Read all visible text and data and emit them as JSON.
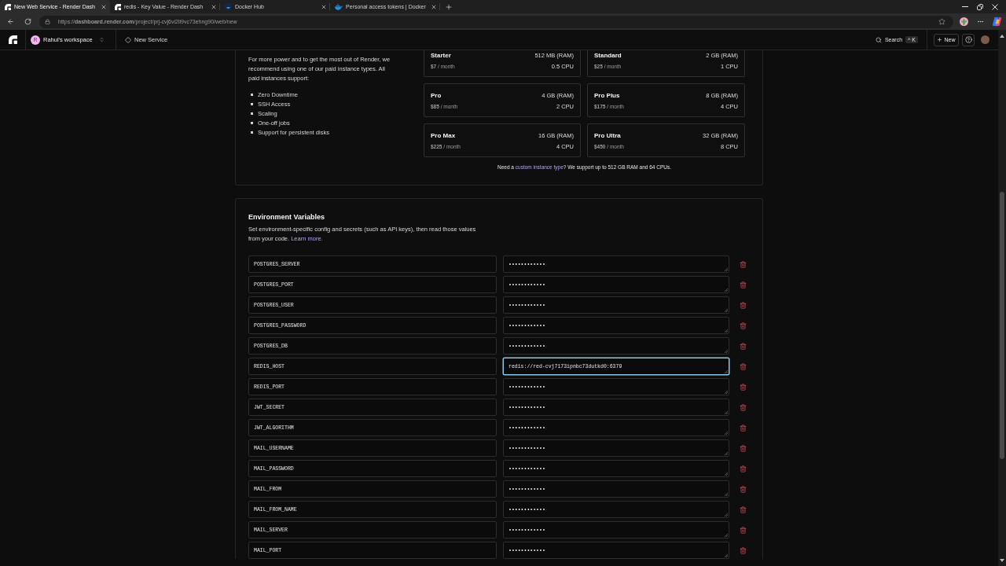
{
  "browser": {
    "tabs": [
      {
        "title": "New Web Service - Render Dash",
        "kind": "render",
        "selected": true
      },
      {
        "title": "redis - Key Value - Render Dash",
        "kind": "render",
        "selected": false
      },
      {
        "title": "Docker Hub",
        "kind": "docker-hub",
        "selected": false
      },
      {
        "title": "Personal access tokens | Docker",
        "kind": "docker",
        "selected": false
      }
    ],
    "address": "https://**dashboard.render.com**/project/prj-cvj6vi2li9vc73ehng90/web/new"
  },
  "header": {
    "workspace": {
      "initial": "R",
      "name": "Rahul's workspace"
    },
    "page": "New Service",
    "search": {
      "label": "Search",
      "shortcut": "^ K"
    },
    "new_button": "New"
  },
  "instances": {
    "description": "For more power and to get the most out of Render, we recommend using one of our paid instance types. All paid instances support:",
    "features": [
      "Zero Downtime",
      "SSH Access",
      "Scaling",
      "One-off jobs",
      "Support for persistent disks"
    ],
    "plans": [
      {
        "name": "Starter",
        "ram": "512 MB (RAM)",
        "price": "**$7** / month",
        "cpu": "0.5 CPU",
        "selected": false
      },
      {
        "name": "Standard",
        "ram": "2 GB (RAM)",
        "price": "**$25** / month",
        "cpu": "1 CPU",
        "selected": false
      },
      {
        "name": "Pro",
        "ram": "4 GB (RAM)",
        "price": "**$85** / month",
        "cpu": "2 CPU",
        "selected": false
      },
      {
        "name": "Pro Plus",
        "ram": "8 GB (RAM)",
        "price": "**$175** / month",
        "cpu": "4 CPU",
        "selected": false
      },
      {
        "name": "Pro Max",
        "ram": "16 GB (RAM)",
        "price": "**$225** / month",
        "cpu": "4 CPU",
        "selected": false
      },
      {
        "name": "Pro Ultra",
        "ram": "32 GB (RAM)",
        "price": "**$450** / month",
        "cpu": "8 CPU",
        "selected": false
      }
    ],
    "note": {
      "before": "Need a ",
      "link": "custom instance type",
      "after": "? We support up to 512 GB RAM and 64 CPUs."
    }
  },
  "environment": {
    "title": "Environment Variables",
    "description": "Set environment-specific config and secrets (such as API keys), then read those values from your code.",
    "link": "Learn more.",
    "variables": [
      {
        "key": "POSTGRES_SERVER",
        "value": "••••••••••••",
        "focused": false
      },
      {
        "key": "POSTGRES_PORT",
        "value": "••••••••••••",
        "focused": false
      },
      {
        "key": "POSTGRES_USER",
        "value": "••••••••••••",
        "focused": false
      },
      {
        "key": "POSTGRES_PASSWORD",
        "value": "••••••••••••",
        "focused": false
      },
      {
        "key": "POSTGRES_DB",
        "value": "••••••••••••",
        "focused": false
      },
      {
        "key": "REDIS_HOST",
        "value": "redis://red-cvj7173ipnbc73dutkd0:6379",
        "focused": true
      },
      {
        "key": "REDIS_PORT",
        "value": "••••••••••••",
        "focused": false
      },
      {
        "key": "JWT_SECRET",
        "value": "••••••••••••",
        "focused": false
      },
      {
        "key": "JWT_ALGORITHM",
        "value": "••••••••••••",
        "focused": false
      },
      {
        "key": "MAIL_USERNAME",
        "value": "••••••••••••",
        "focused": false
      },
      {
        "key": "MAIL_PASSWORD",
        "value": "••••••••••••",
        "focused": false
      },
      {
        "key": "MAIL_FROM",
        "value": "••••••••••••",
        "focused": false
      },
      {
        "key": "MAIL_FROM_NAME",
        "value": "••••••••••••",
        "focused": false
      },
      {
        "key": "MAIL_SERVER",
        "value": "••••••••••••",
        "focused": false
      },
      {
        "key": "MAIL_PORT",
        "value": "••••••••••••",
        "focused": false
      }
    ]
  }
}
